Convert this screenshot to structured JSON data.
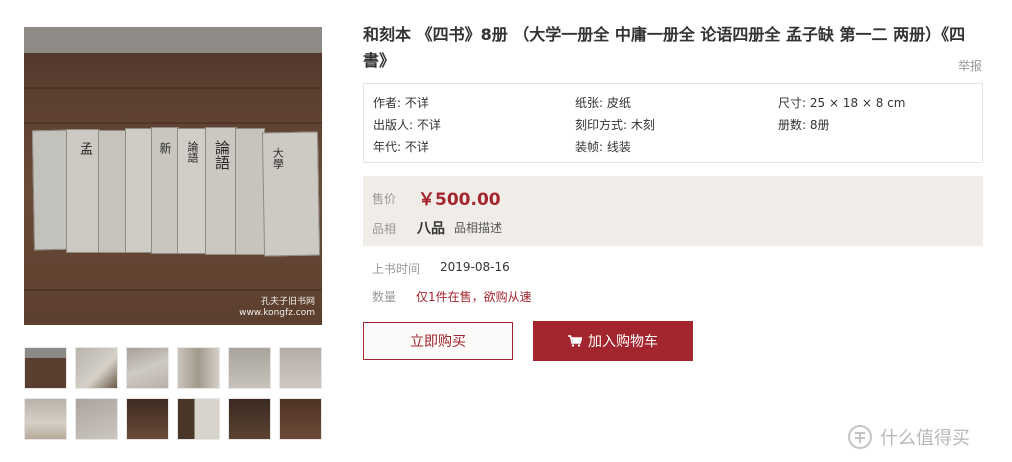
{
  "product": {
    "title": "和刻本 《四书》8册 （大学一册全 中庸一册全 论语四册全 孟子缺 第一二 两册）《四書》",
    "report_label": "举报"
  },
  "photo": {
    "spine_labels": [
      "孟",
      "",
      "",
      "新",
      "論語",
      "論語",
      "",
      "大學"
    ],
    "watermark_name": "孔夫子旧书网",
    "watermark_url": "www.kongfz.com"
  },
  "attributes": {
    "author": "作者: 不详",
    "paper": "纸张: 皮纸",
    "size": "尺寸: 25 × 18 × 8 cm",
    "publisher": "出版人: 不详",
    "print_method": "刻印方式: 木刻",
    "volumes": "册数: 8册",
    "era": "年代: 不详",
    "binding": "装帧: 线装"
  },
  "price": {
    "label": "售价",
    "value": "￥500.00",
    "grade_label": "品相",
    "grade_value": "八品",
    "grade_desc_link": "品相描述"
  },
  "listing": {
    "date_label": "上书时间",
    "date_value": "2019-08-16",
    "qty_label": "数量",
    "qty_value": "仅1件在售，欲购从速"
  },
  "actions": {
    "buy_now": "立即购买",
    "add_to_cart": "加入购物车"
  },
  "watermark_site": "什么值得买",
  "colors": {
    "accent": "#a3252d",
    "price_bg": "#f0ede8"
  }
}
